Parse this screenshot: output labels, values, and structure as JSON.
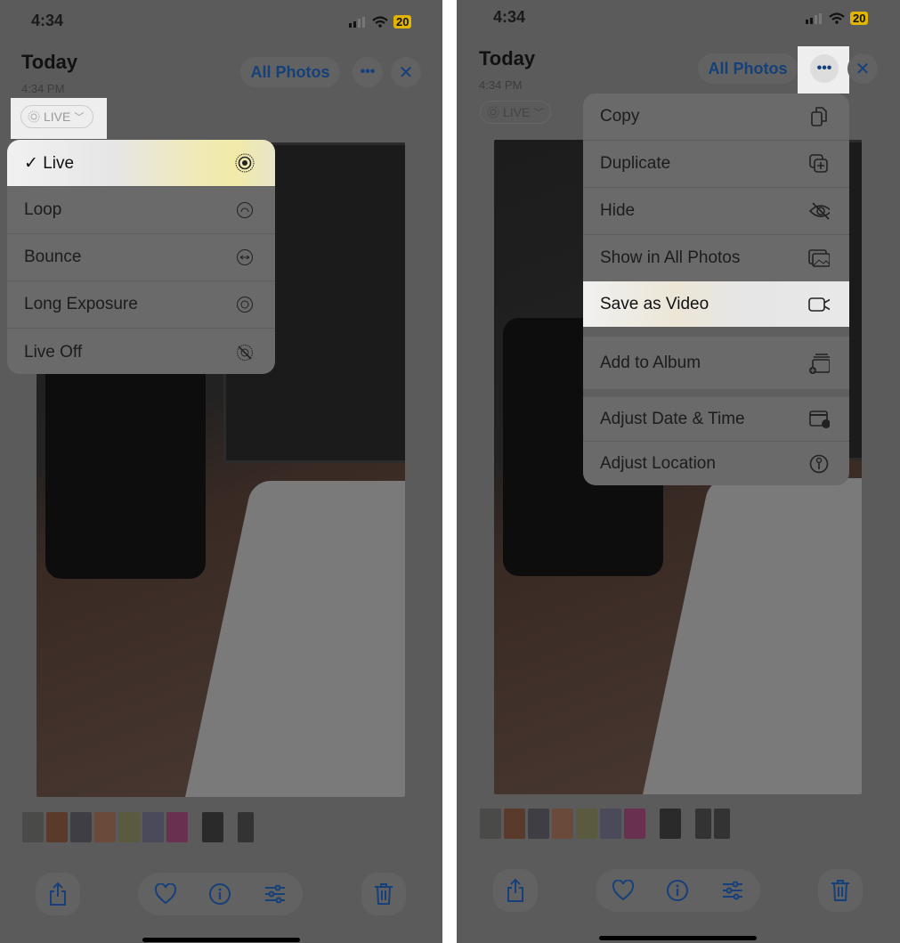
{
  "left": {
    "status": {
      "time": "4:34",
      "battery": "20"
    },
    "header": {
      "title": "Today",
      "subtitle": "4:34 PM",
      "all_photos": "All Photos",
      "live_badge": "LIVE"
    },
    "live_menu": {
      "items": [
        {
          "label": "Live",
          "checked": true,
          "icon": "live-icon"
        },
        {
          "label": "Loop",
          "icon": "loop-icon"
        },
        {
          "label": "Bounce",
          "icon": "bounce-icon"
        },
        {
          "label": "Long Exposure",
          "icon": "long-exposure-icon"
        },
        {
          "label": "Live Off",
          "icon": "live-off-icon"
        }
      ],
      "check": "✓"
    }
  },
  "right": {
    "status": {
      "time": "4:34",
      "battery": "20"
    },
    "header": {
      "title": "Today",
      "subtitle": "4:34 PM",
      "all_photos": "All Photos",
      "live_badge": "LIVE"
    },
    "more_menu": {
      "items": [
        {
          "label": "Copy",
          "icon": "copy-icon"
        },
        {
          "label": "Duplicate",
          "icon": "duplicate-icon"
        },
        {
          "label": "Hide",
          "icon": "hide-icon"
        },
        {
          "label": "Show in All Photos",
          "icon": "photos-icon"
        },
        {
          "label": "Save as Video",
          "icon": "video-icon",
          "highlighted": true
        },
        {
          "label": "Add to Album",
          "icon": "add-album-icon"
        },
        {
          "label": "Adjust Date & Time",
          "icon": "calendar-icon"
        },
        {
          "label": "Adjust Location",
          "icon": "location-icon"
        }
      ]
    }
  },
  "toolbar": {
    "icons": [
      "share-icon",
      "heart-icon",
      "info-icon",
      "adjust-icon",
      "trash-icon"
    ]
  },
  "colors": {
    "accent": "#16407a",
    "dim_background": "#5b5b5b",
    "highlight": "#eeeeee",
    "battery": "#e0b400"
  }
}
